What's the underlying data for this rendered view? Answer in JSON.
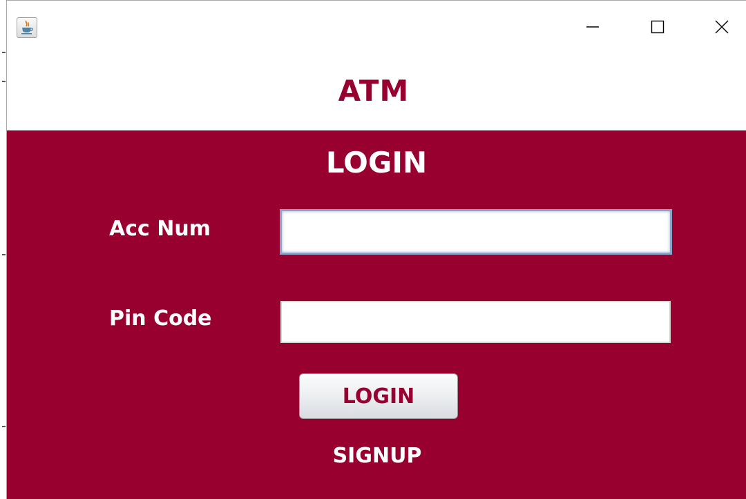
{
  "window": {
    "icon": "java-app-icon",
    "controls": {
      "minimize_icon": "minimize-icon",
      "maximize_icon": "maximize-icon",
      "close_icon": "close-icon"
    }
  },
  "header": {
    "brand": "ATM"
  },
  "login_panel": {
    "title": "LOGIN",
    "acc_num_label": "Acc Num",
    "acc_num_value": "",
    "pin_code_label": "Pin Code",
    "pin_code_value": "",
    "login_button_label": "LOGIN",
    "signup_link_label": "SIGNUP"
  },
  "colors": {
    "brand": "#980030",
    "panel_background": "#980030",
    "text_on_panel": "#ffffff"
  }
}
